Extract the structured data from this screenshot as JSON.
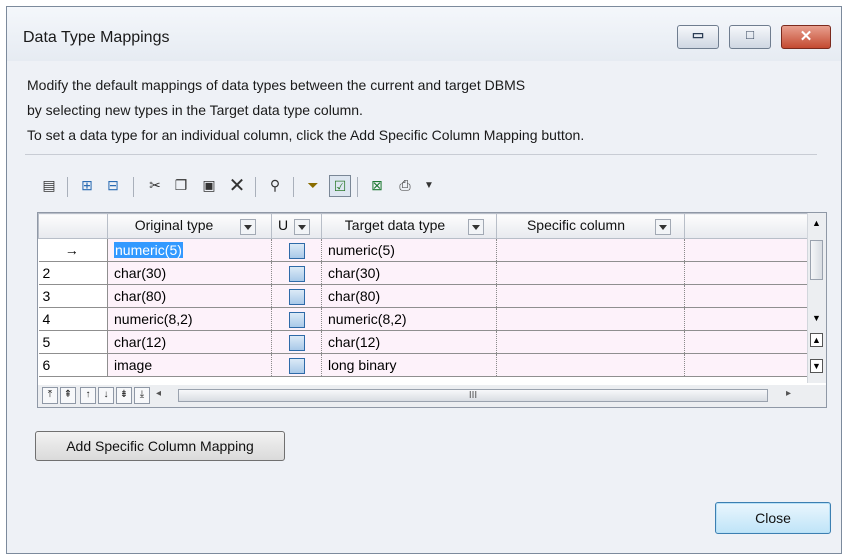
{
  "window": {
    "title": "Data Type Mappings",
    "minimize_glyph": "▭",
    "maximize_glyph": "□",
    "close_glyph": "✕"
  },
  "description": [
    "Modify the default mappings of data types between the current and target DBMS",
    "by selecting new types in the Target data type column.",
    "To set a data type for an individual column, click the Add Specific Column Mapping button."
  ],
  "toolbar": {
    "icons": [
      "properties-icon",
      "insert-row-icon",
      "add-row-icon",
      "cut-icon",
      "copy-icon",
      "paste-icon",
      "delete-icon",
      "find-icon",
      "filter-icon",
      "enable-filter-icon",
      "excel-export-icon",
      "print-icon",
      "dropdown-arrow-icon"
    ]
  },
  "grid": {
    "columns": [
      "Original type",
      "U",
      "Target data type",
      "Specific column"
    ],
    "rows": [
      {
        "header": "→",
        "original": "numeric(5)",
        "target": "numeric(5)",
        "selected": true
      },
      {
        "header": "2",
        "original": "char(30)",
        "target": "char(30)"
      },
      {
        "header": "3",
        "original": "char(80)",
        "target": "char(80)"
      },
      {
        "header": "4",
        "original": "numeric(8,2)",
        "target": "numeric(8,2)"
      },
      {
        "header": "5",
        "original": "char(12)",
        "target": "char(12)"
      },
      {
        "header": "6",
        "original": "image",
        "target": "long binary"
      }
    ],
    "scroll_thumb_glyph": "III"
  },
  "buttons": {
    "add_mapping": "Add Specific Column Mapping",
    "close": "Close"
  }
}
